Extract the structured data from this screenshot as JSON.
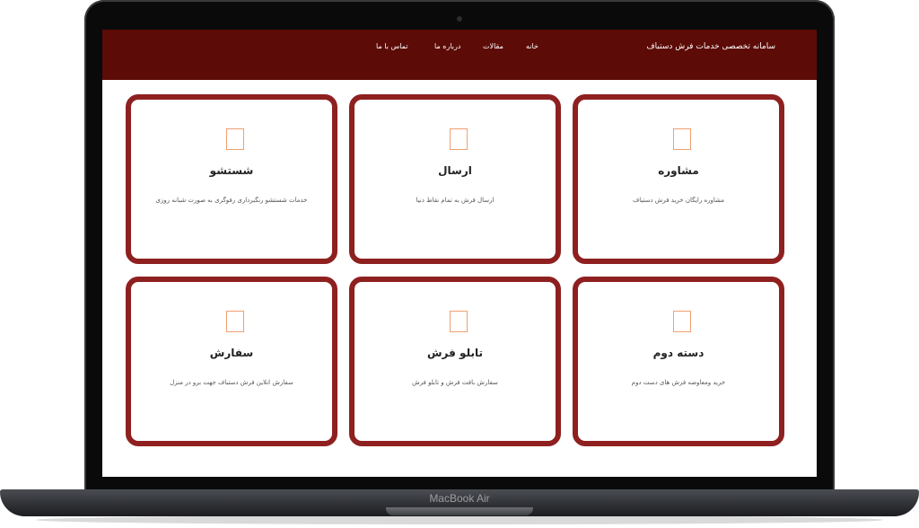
{
  "device": {
    "label": "MacBook Air"
  },
  "header": {
    "site_title": "سامانه تخصصی خدمات فرش دستباف",
    "nav": [
      {
        "label": "خانه"
      },
      {
        "label": "مقالات"
      },
      {
        "label": "درباره ما"
      },
      {
        "label": "تماس با ما"
      }
    ]
  },
  "cards": [
    {
      "title": "مشاوره",
      "description": "مشاوره رایگان خرید فرش دستباف",
      "icon": "image-placeholder-icon"
    },
    {
      "title": "ارسال",
      "description": "ارسال فرش به تمام نقاط دنیا",
      "icon": "image-placeholder-icon"
    },
    {
      "title": "شستشو",
      "description": "خدمات شستشو رنگبرداری رفوگری به صورت شبانه روزی",
      "icon": "image-placeholder-icon"
    },
    {
      "title": "دسته دوم",
      "description": "خرید ومعاوضه فرش های دست دوم",
      "icon": "image-placeholder-icon"
    },
    {
      "title": "تابلو فرش",
      "description": "سفارش بافت فرش و تابلو فرش",
      "icon": "image-placeholder-icon"
    },
    {
      "title": "سفارش",
      "description": "سفارش انلاین فرش دستباف جهت برو در منزل",
      "icon": "image-placeholder-icon"
    }
  ],
  "colors": {
    "header_bg": "#5c0b07",
    "card_border": "#8f2020",
    "icon_outline": "#f0a070"
  }
}
